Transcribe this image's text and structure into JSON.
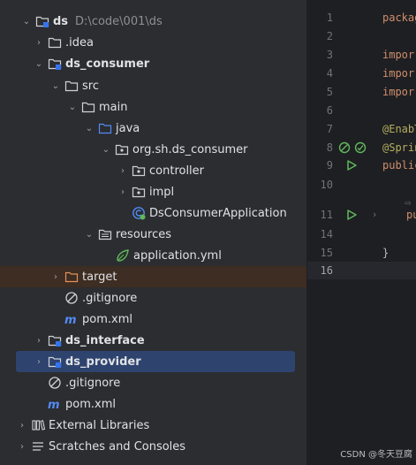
{
  "project_tree": {
    "root": {
      "label": "ds",
      "path": "D:\\code\\001\\ds"
    },
    "idea": ".idea",
    "ds_consumer": "ds_consumer",
    "src": "src",
    "main": "main",
    "java": "java",
    "package": "org.sh.ds_consumer",
    "controller": "controller",
    "impl": "impl",
    "app_class": "DsConsumerApplication",
    "resources": "resources",
    "app_yml": "application.yml",
    "target": "target",
    "consumer_gitignore": ".gitignore",
    "consumer_pom": "pom.xml",
    "ds_interface": "ds_interface",
    "ds_provider": "ds_provider",
    "root_gitignore": ".gitignore",
    "root_pom": "pom.xml",
    "external_libraries": "External Libraries",
    "scratches": "Scratches and Consoles"
  },
  "editor": {
    "line_numbers": [
      "1",
      "2",
      "3",
      "4",
      "5",
      "6",
      "7",
      "8",
      "9",
      "10",
      "11",
      "14",
      "15",
      "16"
    ],
    "code": {
      "l1": "packag",
      "l3": "impor",
      "l4": "impor",
      "l5": "impor",
      "l7": "@EnabT",
      "l8": "@Sprin",
      "l9": "public",
      "l11a": "⇨",
      "l11b": "pu",
      "l15": "}"
    }
  },
  "watermark": "CSDN @冬天豆腐",
  "colors": {
    "tree_bg": "#2b2d30",
    "editor_bg": "#1e1f22",
    "selection": "#2e436e",
    "excluded_row": "#3d2d22",
    "keyword": "#cf8e6d",
    "annotation": "#b3ae60",
    "run_icon": "#5fb85c"
  }
}
